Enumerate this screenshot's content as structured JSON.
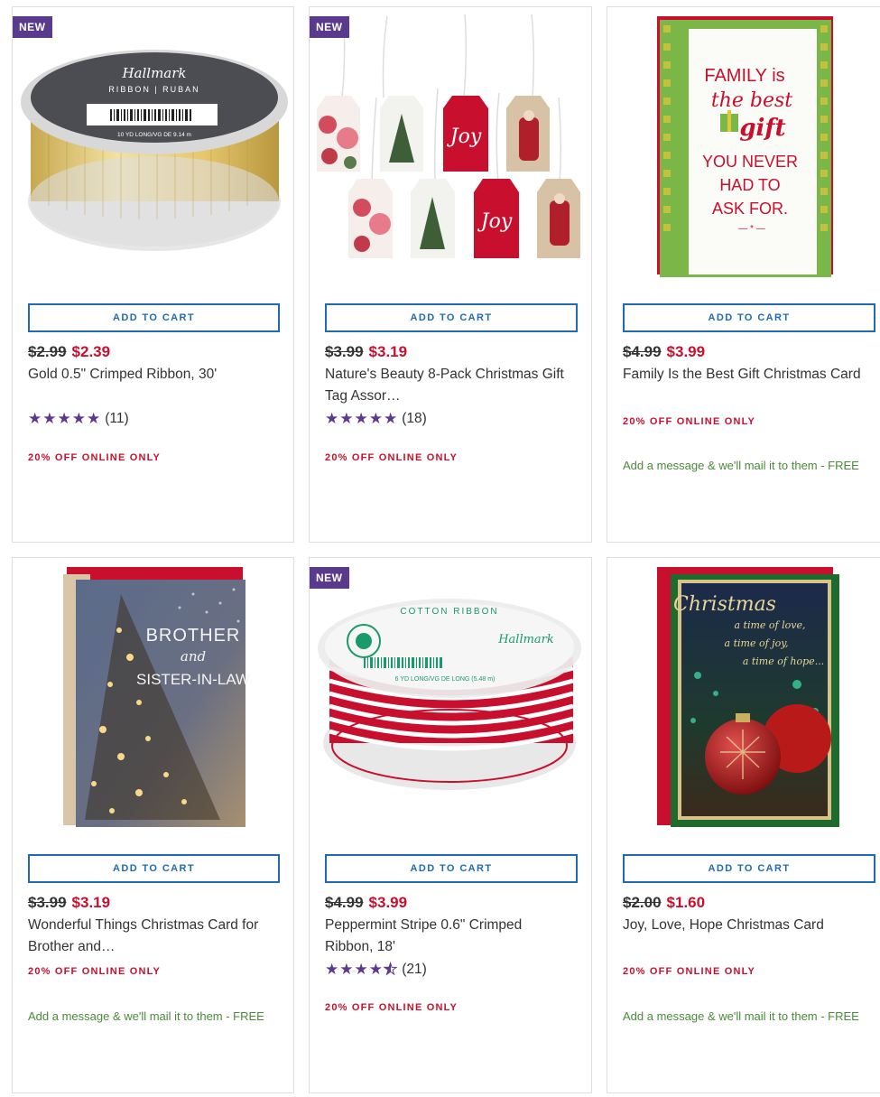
{
  "products": [
    {
      "badge": "NEW",
      "add_to_cart": "ADD TO CART",
      "old_price": "$2.99",
      "new_price": "$2.39",
      "name": "Gold 0.5\" Crimped Ribbon, 30'",
      "rating": 5,
      "review_count": "(11)",
      "promo": "20% OFF ONLINE ONLY",
      "mail_note": "",
      "image_text": {
        "brand": "Hallmark",
        "line": "RIBBON | RUBAN",
        "length": "10 YD LONG/VG DE 9.14 m"
      }
    },
    {
      "badge": "NEW",
      "add_to_cart": "ADD TO CART",
      "old_price": "$3.99",
      "new_price": "$3.19",
      "name": "Nature's Beauty 8-Pack Christmas Gift Tag Assor…",
      "rating": 5,
      "review_count": "(18)",
      "promo": "20% OFF ONLINE ONLY",
      "mail_note": "",
      "image_text": {
        "tag_word": "Joy"
      }
    },
    {
      "badge": "",
      "add_to_cart": "ADD TO CART",
      "old_price": "$4.99",
      "new_price": "$3.99",
      "name": "Family Is the Best Gift Christmas Card",
      "rating": null,
      "review_count": "",
      "promo": "20% OFF ONLINE ONLY",
      "mail_note": "Add a message & we'll mail it to them - FREE",
      "image_text": {
        "l1": "FAMILY is",
        "l2": "the best",
        "l3": "gift",
        "l4": "YOU NEVER",
        "l5": "HAD TO",
        "l6": "ASK FOR."
      }
    },
    {
      "badge": "",
      "add_to_cart": "ADD TO CART",
      "old_price": "$3.99",
      "new_price": "$3.19",
      "name": "Wonderful Things Christmas Card for Brother and…",
      "rating": null,
      "review_count": "",
      "promo": "20% OFF ONLINE ONLY",
      "mail_note": "Add a message & we'll mail it to them - FREE",
      "image_text": {
        "l1": "BROTHER",
        "l2": "and",
        "l3": "SISTER-IN-LAW"
      }
    },
    {
      "badge": "NEW",
      "add_to_cart": "ADD TO CART",
      "old_price": "$4.99",
      "new_price": "$3.99",
      "name": "Peppermint Stripe 0.6\" Crimped Ribbon, 18'",
      "rating": 4.5,
      "review_count": "(21)",
      "promo": "20% OFF ONLINE ONLY",
      "mail_note": "",
      "image_text": {
        "label": "COTTON RIBBON",
        "brand": "Hallmark",
        "length": "6 YD LONG/VG DE LONG (5.48 m)"
      }
    },
    {
      "badge": "",
      "add_to_cart": "ADD TO CART",
      "old_price": "$2.00",
      "new_price": "$1.60",
      "name": "Joy, Love, Hope Christmas Card",
      "rating": null,
      "review_count": "",
      "promo": "20% OFF ONLINE ONLY",
      "mail_note": "Add a message & we'll mail it to them - FREE",
      "image_text": {
        "title": "Christmas",
        "l1": "a time of love,",
        "l2": "a time of joy,",
        "l3": "a time of hope..."
      }
    }
  ],
  "colors": {
    "badge": "#5a3a8c",
    "button_border": "#1f6bb3",
    "sale_price": "#c8102e",
    "star": "#5a3a8c",
    "mail_note": "#4a8a3a"
  }
}
